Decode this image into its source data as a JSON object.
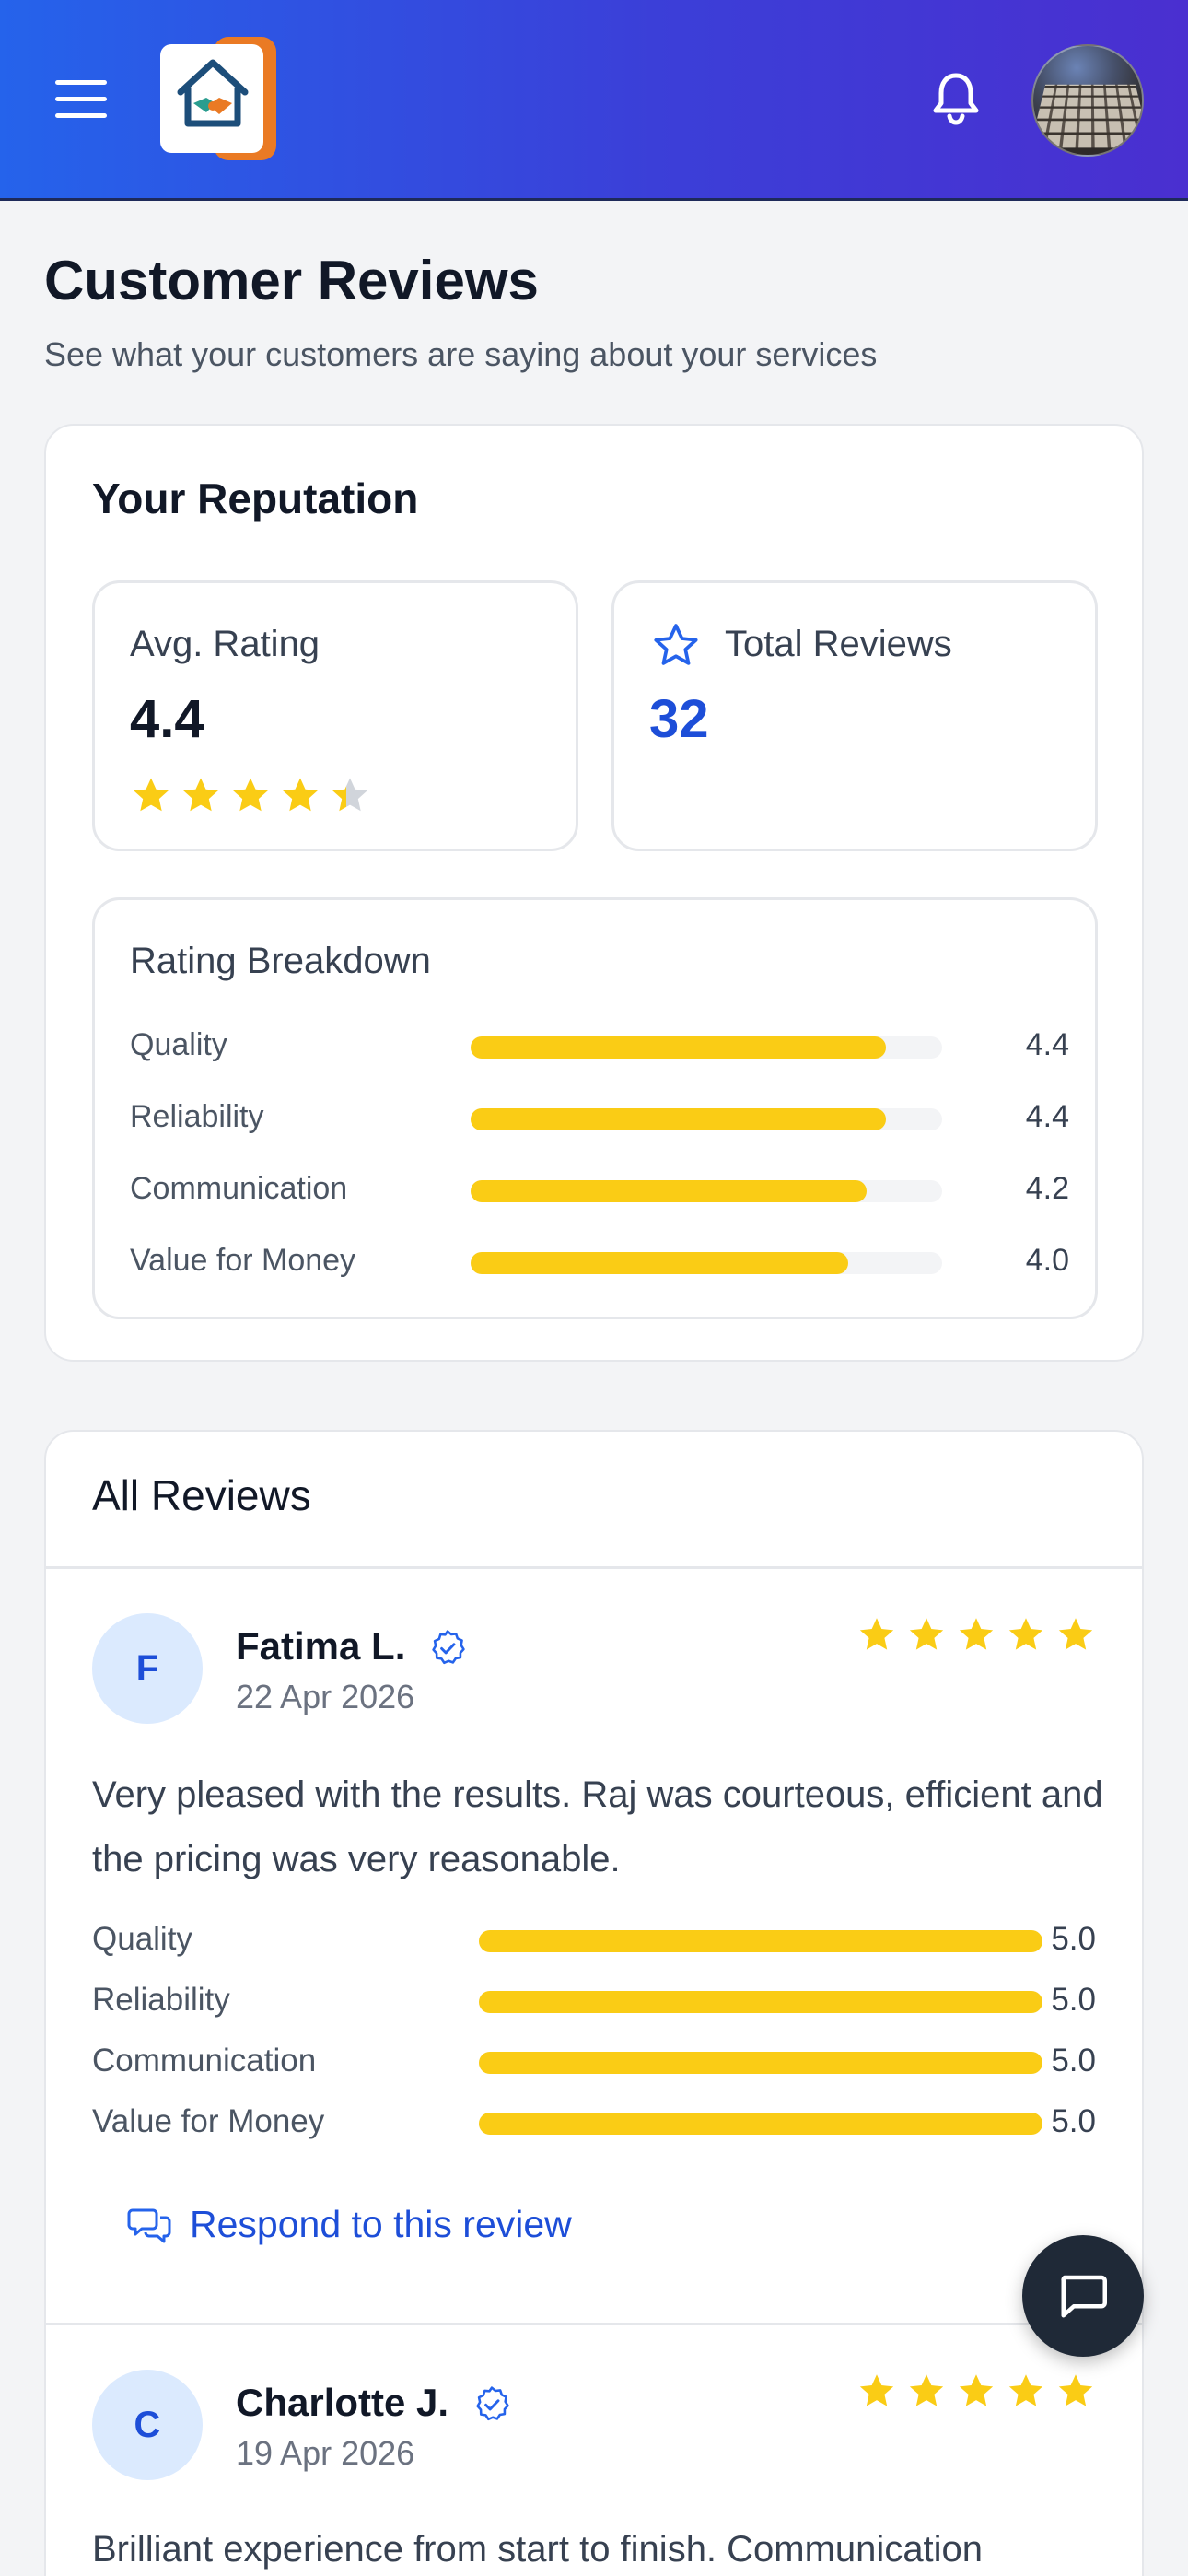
{
  "header": {
    "menu_icon": "hamburger-menu-icon",
    "logo_icon": "house-handshake-logo",
    "notification_icon": "bell-icon",
    "avatar": "user-avatar-keyboard-photo"
  },
  "page": {
    "title": "Customer Reviews",
    "subtitle": "See what your customers are saying about your services"
  },
  "reputation": {
    "title": "Your Reputation",
    "avg_rating_label": "Avg. Rating",
    "avg_rating_value": "4.4",
    "avg_rating_stars": 4.4,
    "total_reviews_label": "Total Reviews",
    "total_reviews_value": "32",
    "breakdown_title": "Rating Breakdown",
    "breakdown": [
      {
        "label": "Quality",
        "value": "4.4",
        "fraction": 0.88
      },
      {
        "label": "Reliability",
        "value": "4.4",
        "fraction": 0.88
      },
      {
        "label": "Communication",
        "value": "4.2",
        "fraction": 0.84
      },
      {
        "label": "Value for Money",
        "value": "4.0",
        "fraction": 0.8
      }
    ]
  },
  "reviews": {
    "title": "All Reviews",
    "respond_label": "Respond to this review",
    "items": [
      {
        "initial": "F",
        "name": "Fatima L.",
        "date": "22 Apr 2026",
        "stars": 5,
        "text": "Very pleased with the results. Raj was courteous, efficient and the pricing was very reasonable.",
        "breakdown": [
          {
            "label": "Quality",
            "value": "5.0",
            "fraction": 1.0
          },
          {
            "label": "Reliability",
            "value": "5.0",
            "fraction": 1.0
          },
          {
            "label": "Communication",
            "value": "5.0",
            "fraction": 1.0
          },
          {
            "label": "Value for Money",
            "value": "5.0",
            "fraction": 1.0
          }
        ]
      },
      {
        "initial": "C",
        "name": "Charlotte J.",
        "date": "19 Apr 2026",
        "stars": 5,
        "text": "Brilliant experience from start to finish. Communication"
      }
    ]
  },
  "colors": {
    "header_start": "#2563eb",
    "header_end": "#4a2fd0",
    "star": "#facc15",
    "accent": "#1d4ed8"
  },
  "chat_fab_icon": "chat-bubble-icon"
}
